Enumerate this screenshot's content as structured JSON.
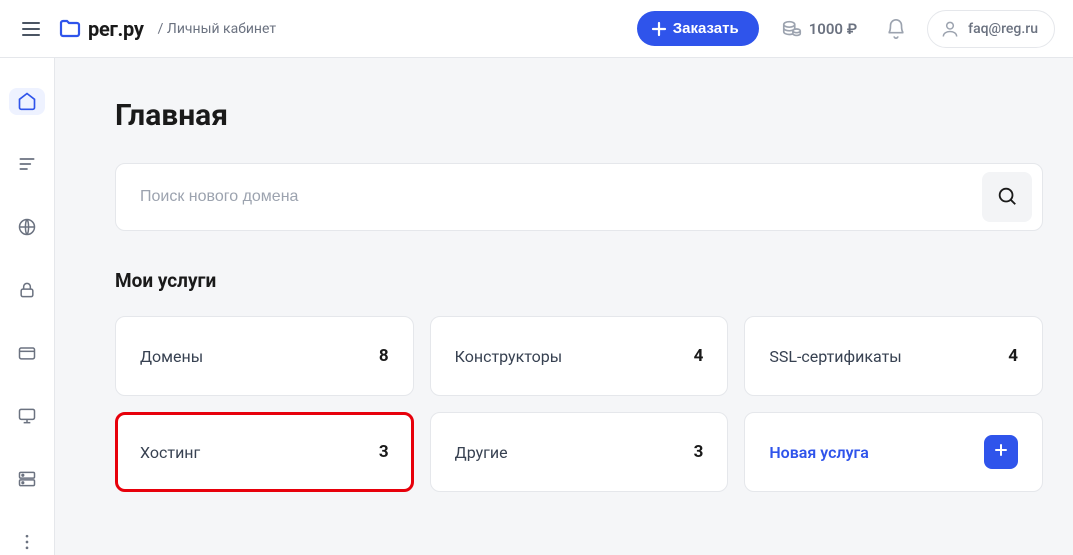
{
  "header": {
    "logo_text": "рег.ру",
    "breadcrumb": "/ Личный кабинет",
    "order_label": "Заказать",
    "balance": "1000 ₽",
    "user_email": "faq@reg.ru"
  },
  "sidebar": {
    "items": [
      {
        "name": "home",
        "active": true
      },
      {
        "name": "list",
        "active": false
      },
      {
        "name": "globe",
        "active": false
      },
      {
        "name": "lock",
        "active": false
      },
      {
        "name": "card",
        "active": false
      },
      {
        "name": "monitor",
        "active": false
      },
      {
        "name": "server",
        "active": false
      },
      {
        "name": "more",
        "active": false
      }
    ]
  },
  "main": {
    "title": "Главная",
    "search_placeholder": "Поиск нового домена",
    "services_title": "Мои услуги",
    "cards": [
      {
        "label": "Домены",
        "count": "8",
        "highlighted": false
      },
      {
        "label": "Конструкторы",
        "count": "4",
        "highlighted": false
      },
      {
        "label": "SSL-сертификаты",
        "count": "4",
        "highlighted": false
      },
      {
        "label": "Хостинг",
        "count": "3",
        "highlighted": true
      },
      {
        "label": "Другие",
        "count": "3",
        "highlighted": false
      }
    ],
    "new_service_label": "Новая услуга"
  }
}
